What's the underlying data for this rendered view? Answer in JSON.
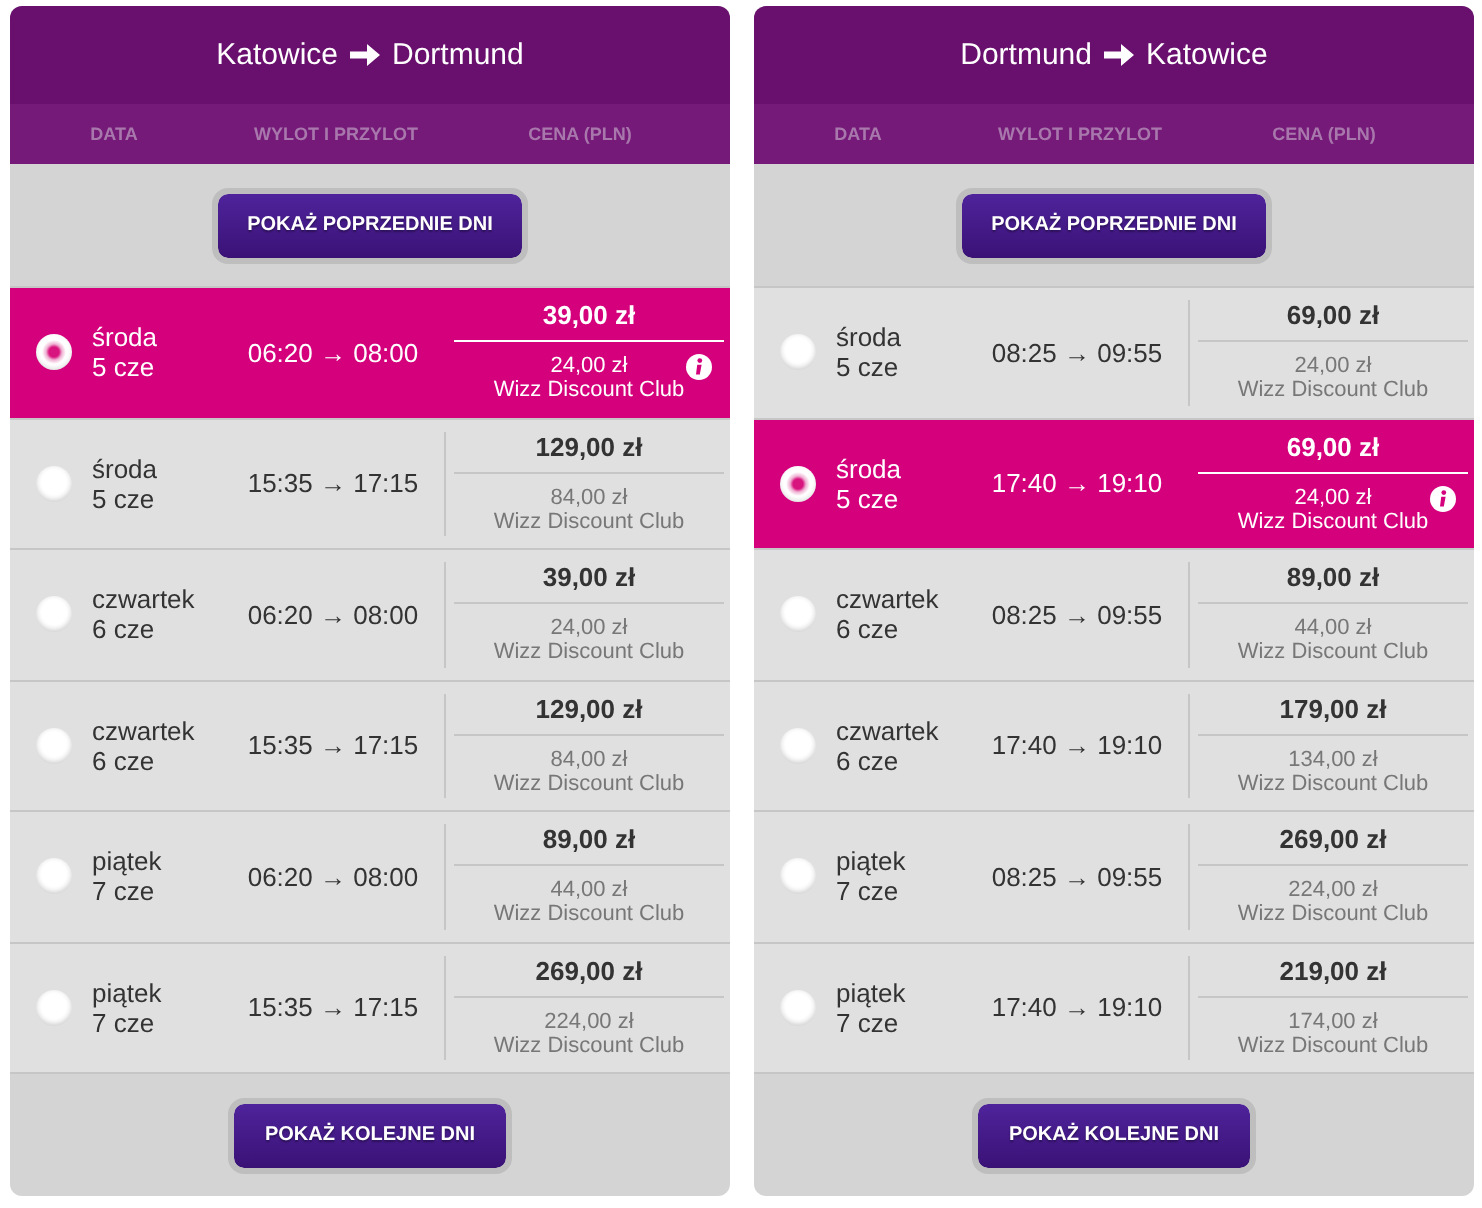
{
  "panels": [
    {
      "route": {
        "origin": "Katowice",
        "destination": "Dortmund"
      },
      "columns": [
        "DATA",
        "WYLOT I PRZYLOT",
        "CENA (PLN)"
      ],
      "previous_button": "POKAŻ POPRZEDNIE DNI",
      "flights": [
        {
          "day": "środa",
          "date": "5 cze",
          "times": "06:20 → 08:00",
          "price": "39,00 zł",
          "club_price": "24,00 zł",
          "club_label": "Wizz Discount Club",
          "selected": true
        },
        {
          "day": "środa",
          "date": "5 cze",
          "times": "15:35 → 17:15",
          "price": "129,00 zł",
          "club_price": "84,00 zł",
          "club_label": "Wizz Discount Club",
          "selected": false
        },
        {
          "day": "czwartek",
          "date": "6 cze",
          "times": "06:20 → 08:00",
          "price": "39,00 zł",
          "club_price": "24,00 zł",
          "club_label": "Wizz Discount Club",
          "selected": false
        },
        {
          "day": "czwartek",
          "date": "6 cze",
          "times": "15:35 → 17:15",
          "price": "129,00 zł",
          "club_price": "84,00 zł",
          "club_label": "Wizz Discount Club",
          "selected": false
        },
        {
          "day": "piątek",
          "date": "7 cze",
          "times": "06:20 → 08:00",
          "price": "89,00 zł",
          "club_price": "44,00 zł",
          "club_label": "Wizz Discount Club",
          "selected": false
        },
        {
          "day": "piątek",
          "date": "7 cze",
          "times": "15:35 → 17:15",
          "price": "269,00 zł",
          "club_price": "224,00 zł",
          "club_label": "Wizz Discount Club",
          "selected": false
        }
      ],
      "next_button": "POKAŻ KOLEJNE DNI"
    },
    {
      "route": {
        "origin": "Dortmund",
        "destination": "Katowice"
      },
      "columns": [
        "DATA",
        "WYLOT I PRZYLOT",
        "CENA (PLN)"
      ],
      "previous_button": "POKAŻ POPRZEDNIE DNI",
      "flights": [
        {
          "day": "środa",
          "date": "5 cze",
          "times": "08:25 → 09:55",
          "price": "69,00 zł",
          "club_price": "24,00 zł",
          "club_label": "Wizz Discount Club",
          "selected": false
        },
        {
          "day": "środa",
          "date": "5 cze",
          "times": "17:40 → 19:10",
          "price": "69,00 zł",
          "club_price": "24,00 zł",
          "club_label": "Wizz Discount Club",
          "selected": true
        },
        {
          "day": "czwartek",
          "date": "6 cze",
          "times": "08:25 → 09:55",
          "price": "89,00 zł",
          "club_price": "44,00 zł",
          "club_label": "Wizz Discount Club",
          "selected": false
        },
        {
          "day": "czwartek",
          "date": "6 cze",
          "times": "17:40 → 19:10",
          "price": "179,00 zł",
          "club_price": "134,00 zł",
          "club_label": "Wizz Discount Club",
          "selected": false
        },
        {
          "day": "piątek",
          "date": "7 cze",
          "times": "08:25 → 09:55",
          "price": "269,00 zł",
          "club_price": "224,00 zł",
          "club_label": "Wizz Discount Club",
          "selected": false
        },
        {
          "day": "piątek",
          "date": "7 cze",
          "times": "17:40 → 19:10",
          "price": "219,00 zł",
          "club_price": "174,00 zł",
          "club_label": "Wizz Discount Club",
          "selected": false
        }
      ],
      "next_button": "POKAŻ KOLEJNE DNI"
    }
  ]
}
